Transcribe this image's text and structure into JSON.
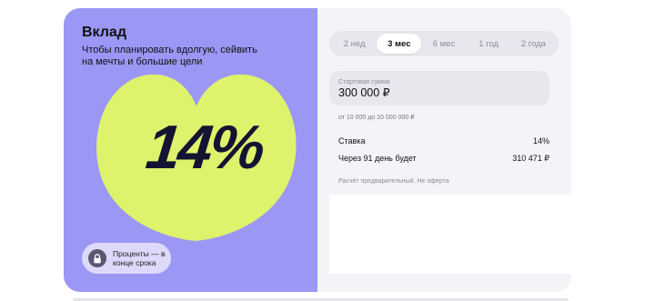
{
  "promo": {
    "title": "Вклад",
    "subtitle": "Чтобы планировать вдолгую, сейвить на мечты и большие цели",
    "rate": "14%",
    "badge_text": "Проценты — в конце срока",
    "badge_icon": "lock-icon",
    "background_color": "#9b97f5",
    "heart_color": "#dff26c"
  },
  "calculator": {
    "term_tabs": [
      {
        "label": "2 нед",
        "active": false
      },
      {
        "label": "3 мес",
        "active": true
      },
      {
        "label": "6 мес",
        "active": false
      },
      {
        "label": "1 год",
        "active": false
      },
      {
        "label": "2 года",
        "active": false
      }
    ],
    "amount": {
      "label": "Стартовая сумма",
      "value": "300 000 ₽"
    },
    "range_hint": "от 10 000 до 10 000 000 ₽",
    "rate_row": {
      "label": "Ставка",
      "value": "14%"
    },
    "result_row": {
      "label": "Через 91 день будет",
      "value": "310 471 ₽"
    },
    "note": "Расчёт предварительный. Не оферта"
  }
}
